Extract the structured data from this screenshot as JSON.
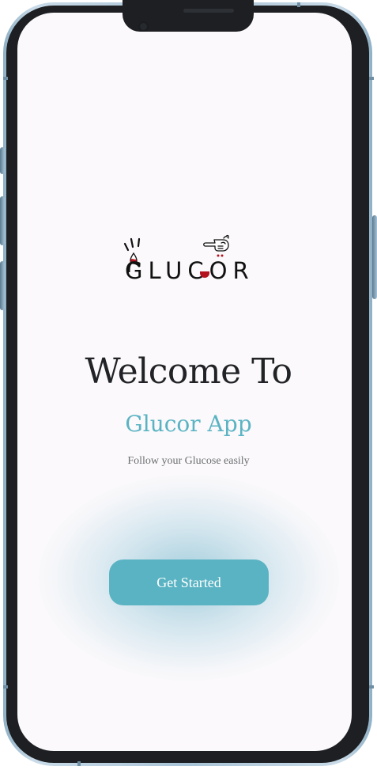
{
  "logo": {
    "text": "GLUCOR",
    "icon": "pointing-hand-icon",
    "drop_icon": "blood-drop-icon",
    "colors": {
      "ink": "#111111",
      "drop": "#b3121e"
    }
  },
  "welcome": {
    "title": "Welcome To",
    "app_name": "Glucor App",
    "tagline": "Follow your Glucose easily"
  },
  "cta": {
    "label": "Get Started"
  },
  "colors": {
    "accent": "#5ab3c3",
    "screen_bg": "#fbf9fb",
    "title": "#222327"
  }
}
